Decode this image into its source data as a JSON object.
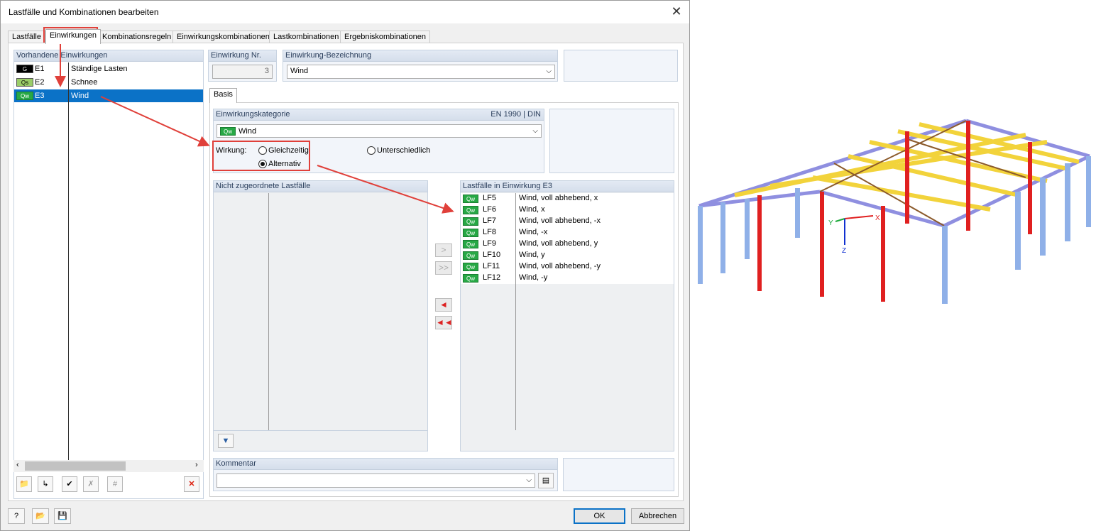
{
  "window": {
    "title": "Lastfälle und Kombinationen bearbeiten",
    "close_icon": "close-icon"
  },
  "tabs": [
    {
      "label": "Lastfälle"
    },
    {
      "label": "Einwirkungen"
    },
    {
      "label": "Kombinationsregeln"
    },
    {
      "label": "Einwirkungskombinationen"
    },
    {
      "label": "Lastkombinationen"
    },
    {
      "label": "Ergebniskombinationen"
    }
  ],
  "actions_list": {
    "header": "Vorhandene Einwirkungen",
    "items": [
      {
        "tag": "G",
        "id": "E1",
        "name": "Ständige Lasten"
      },
      {
        "tag": "Qs",
        "id": "E2",
        "name": "Schnee"
      },
      {
        "tag": "Qw",
        "id": "E3",
        "name": "Wind"
      }
    ]
  },
  "action_no": {
    "label": "Einwirkung Nr.",
    "value": "3"
  },
  "action_name": {
    "label": "Einwirkung-Bezeichnung",
    "value": "Wind"
  },
  "inner_tab": "Basis",
  "category": {
    "label": "Einwirkungskategorie",
    "norm": "EN 1990 | DIN",
    "tag": "Qw",
    "value": "Wind"
  },
  "effect": {
    "label": "Wirkung:",
    "options": [
      "Gleichzeitig",
      "Alternativ",
      "Unterschiedlich"
    ],
    "selected": "Alternativ"
  },
  "unassigned": {
    "header": "Nicht zugeordnete Lastfälle"
  },
  "assigned": {
    "header": "Lastfälle in Einwirkung E3",
    "items": [
      {
        "tag": "Qw",
        "id": "LF5",
        "name": "Wind, voll abhebend, x"
      },
      {
        "tag": "Qw",
        "id": "LF6",
        "name": "Wind, x"
      },
      {
        "tag": "Qw",
        "id": "LF7",
        "name": "Wind, voll abhebend, -x"
      },
      {
        "tag": "Qw",
        "id": "LF8",
        "name": "Wind, -x"
      },
      {
        "tag": "Qw",
        "id": "LF9",
        "name": "Wind, voll abhebend, y"
      },
      {
        "tag": "Qw",
        "id": "LF10",
        "name": "Wind, y"
      },
      {
        "tag": "Qw",
        "id": "LF11",
        "name": "Wind, voll abhebend, -y"
      },
      {
        "tag": "Qw",
        "id": "LF12",
        "name": "Wind, -y"
      }
    ]
  },
  "transfer_buttons": {
    "add": ">",
    "add_all": ">>",
    "remove": "◄",
    "remove_all": "◄◄"
  },
  "comment": {
    "label": "Kommentar",
    "value": ""
  },
  "footer": {
    "ok": "OK",
    "cancel": "Abbrechen"
  },
  "model_axes": {
    "x": "X",
    "y": "Y",
    "z": "Z"
  },
  "colors": {
    "selection": "#0b72c7",
    "highlight": "#e0403a",
    "qw_tag": "#27a845",
    "beam_yellow": "#f2d33b",
    "column_blue": "#8fb0e8",
    "column_red": "#e02020"
  }
}
